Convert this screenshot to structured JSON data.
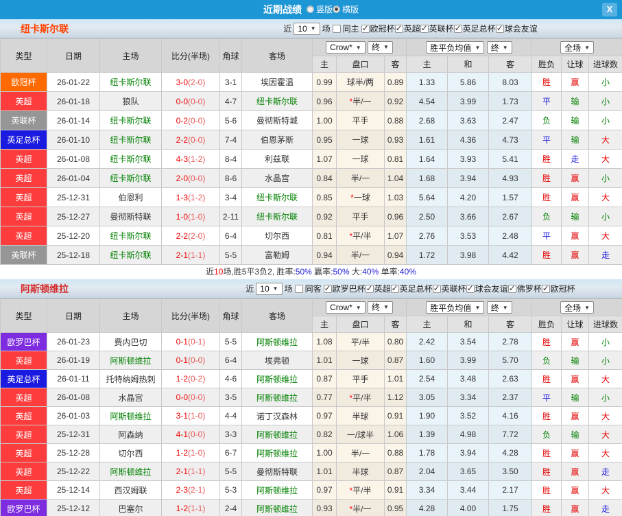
{
  "titlebar": {
    "title": "近期战绩",
    "orientation_options": [
      {
        "label": "竖版",
        "selected": false
      },
      {
        "label": "横版",
        "selected": true
      }
    ],
    "close_label": "X"
  },
  "table_header": {
    "col_type": "类型",
    "col_date": "日期",
    "col_home": "主场",
    "col_score": "比分(半场)",
    "col_corner": "角球",
    "col_away": "客场",
    "crow_select": "Crow*",
    "final_select_1": "终",
    "avg_select": "胜平负均值",
    "final_select_2": "终",
    "scope_select": "全场",
    "sub_home": "主",
    "sub_handicap": "盘口",
    "sub_away": "客",
    "sub_avg_home": "主",
    "sub_avg_draw": "和",
    "sub_avg_away": "客",
    "col_result": "胜负",
    "col_spread": "让球",
    "col_goals": "进球数"
  },
  "comp_colors": {
    "欧冠杯": "#ff6a00",
    "英超": "#fd3d3d",
    "英联杯": "#969696",
    "英足总杯": "#1a1ae0",
    "欧罗巴杯": "#7d2ce0"
  },
  "result_colors": {
    "胜": "#e60000",
    "平": "#1414dc",
    "负": "#018001",
    "赢": "#e60000",
    "输": "#018001",
    "走": "#1414dc",
    "大": "#e60000",
    "小": "#018001"
  },
  "sections": [
    {
      "team": "纽卡斯尔联",
      "team_color": "#ff4200",
      "filters": {
        "near_label": "近",
        "games": "10",
        "games_label": "场",
        "same_label": "同主",
        "same_checked": false,
        "competitions": [
          "欧冠杯",
          "英超",
          "英联杯",
          "英足总杯",
          "球会友谊"
        ]
      },
      "rows": [
        {
          "comp": "欧冠杯",
          "date": "26-01-22",
          "home": "纽卡斯尔联",
          "home_green": true,
          "score": "3-0",
          "half": "(2-0)",
          "corner": "3-1",
          "away": "埃因霍温",
          "away_green": false,
          "crow_home": "0.99",
          "handicap": "球半/两",
          "star": false,
          "crow_away": "0.89",
          "avg_home": "1.33",
          "avg_draw": "5.86",
          "avg_away": "8.03",
          "result": "胜",
          "spread": "赢",
          "goals": "小"
        },
        {
          "comp": "英超",
          "date": "26-01-18",
          "home": "狼队",
          "home_green": false,
          "score": "0-0",
          "half": "(0-0)",
          "corner": "4-7",
          "away": "纽卡斯尔联",
          "away_green": true,
          "crow_home": "0.96",
          "handicap": "半/一",
          "star": true,
          "crow_away": "0.92",
          "avg_home": "4.54",
          "avg_draw": "3.99",
          "avg_away": "1.73",
          "result": "平",
          "spread": "输",
          "goals": "小"
        },
        {
          "comp": "英联杯",
          "date": "26-01-14",
          "home": "纽卡斯尔联",
          "home_green": true,
          "score": "0-2",
          "half": "(0-0)",
          "corner": "5-6",
          "away": "曼彻斯特城",
          "away_green": false,
          "crow_home": "1.00",
          "handicap": "平手",
          "star": false,
          "crow_away": "0.88",
          "avg_home": "2.68",
          "avg_draw": "3.63",
          "avg_away": "2.47",
          "result": "负",
          "spread": "输",
          "goals": "小"
        },
        {
          "comp": "英足总杯",
          "date": "26-01-10",
          "home": "纽卡斯尔联",
          "home_green": true,
          "score": "2-2",
          "half": "(0-0)",
          "corner": "7-4",
          "away": "伯恩茅斯",
          "away_green": false,
          "crow_home": "0.95",
          "handicap": "一球",
          "star": false,
          "crow_away": "0.93",
          "avg_home": "1.61",
          "avg_draw": "4.36",
          "avg_away": "4.73",
          "result": "平",
          "spread": "输",
          "goals": "大"
        },
        {
          "comp": "英超",
          "date": "26-01-08",
          "home": "纽卡斯尔联",
          "home_green": true,
          "score": "4-3",
          "half": "(1-2)",
          "corner": "8-4",
          "away": "利兹联",
          "away_green": false,
          "crow_home": "1.07",
          "handicap": "一球",
          "star": false,
          "crow_away": "0.81",
          "avg_home": "1.64",
          "avg_draw": "3.93",
          "avg_away": "5.41",
          "result": "胜",
          "spread": "走",
          "goals": "大"
        },
        {
          "comp": "英超",
          "date": "26-01-04",
          "home": "纽卡斯尔联",
          "home_green": true,
          "score": "2-0",
          "half": "(0-0)",
          "corner": "8-6",
          "away": "水晶宫",
          "away_green": false,
          "crow_home": "0.84",
          "handicap": "半/一",
          "star": false,
          "crow_away": "1.04",
          "avg_home": "1.68",
          "avg_draw": "3.94",
          "avg_away": "4.93",
          "result": "胜",
          "spread": "赢",
          "goals": "小"
        },
        {
          "comp": "英超",
          "date": "25-12-31",
          "home": "伯恩利",
          "home_green": false,
          "score": "1-3",
          "half": "(1-2)",
          "corner": "3-4",
          "away": "纽卡斯尔联",
          "away_green": true,
          "crow_home": "0.85",
          "handicap": "一球",
          "star": true,
          "crow_away": "1.03",
          "avg_home": "5.64",
          "avg_draw": "4.20",
          "avg_away": "1.57",
          "result": "胜",
          "spread": "赢",
          "goals": "大"
        },
        {
          "comp": "英超",
          "date": "25-12-27",
          "home": "曼彻斯特联",
          "home_green": false,
          "score": "1-0",
          "half": "(1-0)",
          "corner": "2-11",
          "away": "纽卡斯尔联",
          "away_green": true,
          "crow_home": "0.92",
          "handicap": "平手",
          "star": false,
          "crow_away": "0.96",
          "avg_home": "2.50",
          "avg_draw": "3.66",
          "avg_away": "2.67",
          "result": "负",
          "spread": "输",
          "goals": "小"
        },
        {
          "comp": "英超",
          "date": "25-12-20",
          "home": "纽卡斯尔联",
          "home_green": true,
          "score": "2-2",
          "half": "(2-0)",
          "corner": "6-4",
          "away": "切尔西",
          "away_green": false,
          "crow_home": "0.81",
          "handicap": "平/半",
          "star": true,
          "crow_away": "1.07",
          "avg_home": "2.76",
          "avg_draw": "3.53",
          "avg_away": "2.48",
          "result": "平",
          "spread": "赢",
          "goals": "大"
        },
        {
          "comp": "英联杯",
          "date": "25-12-18",
          "home": "纽卡斯尔联",
          "home_green": true,
          "score": "2-1",
          "half": "(1-1)",
          "corner": "5-5",
          "away": "富勒姆",
          "away_green": false,
          "crow_home": "0.94",
          "handicap": "半/一",
          "star": false,
          "crow_away": "0.94",
          "avg_home": "1.72",
          "avg_draw": "3.98",
          "avg_away": "4.42",
          "result": "胜",
          "spread": "赢",
          "goals": "走"
        }
      ],
      "summary": [
        {
          "text": "近",
          "color": "#333333"
        },
        {
          "text": "10",
          "color": "#f00000"
        },
        {
          "text": "场,胜5平3负2, 胜率:",
          "color": "#333333"
        },
        {
          "text": "50%",
          "color": "#2323d6"
        },
        {
          "text": " 赢率:",
          "color": "#333333"
        },
        {
          "text": "50%",
          "color": "#2323d6"
        },
        {
          "text": " 大:",
          "color": "#333333"
        },
        {
          "text": "40%",
          "color": "#2323d6"
        },
        {
          "text": " 单率:",
          "color": "#333333"
        },
        {
          "text": "40%",
          "color": "#2323d6"
        }
      ]
    },
    {
      "team": "阿斯顿维拉",
      "team_color": "#d42a2a",
      "filters": {
        "near_label": "近",
        "games": "10",
        "games_label": "场",
        "same_label": "同客",
        "same_checked": false,
        "competitions": [
          "欧罗巴杯",
          "英超",
          "英足总杯",
          "英联杯",
          "球会友谊",
          "佛罗杯",
          "欧冠杯"
        ]
      },
      "rows": [
        {
          "comp": "欧罗巴杯",
          "date": "26-01-23",
          "home": "费内巴切",
          "home_green": false,
          "score": "0-1",
          "half": "(0-1)",
          "corner": "5-5",
          "away": "阿斯顿维拉",
          "away_green": true,
          "crow_home": "1.08",
          "handicap": "平/半",
          "star": false,
          "crow_away": "0.80",
          "avg_home": "2.42",
          "avg_draw": "3.54",
          "avg_away": "2.78",
          "result": "胜",
          "spread": "赢",
          "goals": "小"
        },
        {
          "comp": "英超",
          "date": "26-01-19",
          "home": "阿斯顿维拉",
          "home_green": true,
          "score": "0-1",
          "half": "(0-0)",
          "corner": "6-4",
          "away": "埃弗顿",
          "away_green": false,
          "crow_home": "1.01",
          "handicap": "一球",
          "star": false,
          "crow_away": "0.87",
          "avg_home": "1.60",
          "avg_draw": "3.99",
          "avg_away": "5.70",
          "result": "负",
          "spread": "输",
          "goals": "小"
        },
        {
          "comp": "英足总杯",
          "date": "26-01-11",
          "home": "托特纳姆热刺",
          "home_green": false,
          "score": "1-2",
          "half": "(0-2)",
          "corner": "4-6",
          "away": "阿斯顿维拉",
          "away_green": true,
          "crow_home": "0.87",
          "handicap": "平手",
          "star": false,
          "crow_away": "1.01",
          "avg_home": "2.54",
          "avg_draw": "3.48",
          "avg_away": "2.63",
          "result": "胜",
          "spread": "赢",
          "goals": "大"
        },
        {
          "comp": "英超",
          "date": "26-01-08",
          "home": "水晶宫",
          "home_green": false,
          "score": "0-0",
          "half": "(0-0)",
          "corner": "3-5",
          "away": "阿斯顿维拉",
          "away_green": true,
          "crow_home": "0.77",
          "handicap": "平/半",
          "star": true,
          "crow_away": "1.12",
          "avg_home": "3.05",
          "avg_draw": "3.34",
          "avg_away": "2.37",
          "result": "平",
          "spread": "输",
          "goals": "小"
        },
        {
          "comp": "英超",
          "date": "26-01-03",
          "home": "阿斯顿维拉",
          "home_green": true,
          "score": "3-1",
          "half": "(1-0)",
          "corner": "4-4",
          "away": "诺丁汉森林",
          "away_green": false,
          "crow_home": "0.97",
          "handicap": "半球",
          "star": false,
          "crow_away": "0.91",
          "avg_home": "1.90",
          "avg_draw": "3.52",
          "avg_away": "4.16",
          "result": "胜",
          "spread": "赢",
          "goals": "大"
        },
        {
          "comp": "英超",
          "date": "25-12-31",
          "home": "阿森纳",
          "home_green": false,
          "score": "4-1",
          "half": "(0-0)",
          "corner": "3-3",
          "away": "阿斯顿维拉",
          "away_green": true,
          "crow_home": "0.82",
          "handicap": "一/球半",
          "star": false,
          "crow_away": "1.06",
          "avg_home": "1.39",
          "avg_draw": "4.98",
          "avg_away": "7.72",
          "result": "负",
          "spread": "输",
          "goals": "大"
        },
        {
          "comp": "英超",
          "date": "25-12-28",
          "home": "切尔西",
          "home_green": false,
          "score": "1-2",
          "half": "(1-0)",
          "corner": "6-7",
          "away": "阿斯顿维拉",
          "away_green": true,
          "crow_home": "1.00",
          "handicap": "半/一",
          "star": false,
          "crow_away": "0.88",
          "avg_home": "1.78",
          "avg_draw": "3.94",
          "avg_away": "4.28",
          "result": "胜",
          "spread": "赢",
          "goals": "大"
        },
        {
          "comp": "英超",
          "date": "25-12-22",
          "home": "阿斯顿维拉",
          "home_green": true,
          "score": "2-1",
          "half": "(1-1)",
          "corner": "5-5",
          "away": "曼彻斯特联",
          "away_green": false,
          "crow_home": "1.01",
          "handicap": "半球",
          "star": false,
          "crow_away": "0.87",
          "avg_home": "2.04",
          "avg_draw": "3.65",
          "avg_away": "3.50",
          "result": "胜",
          "spread": "赢",
          "goals": "走"
        },
        {
          "comp": "英超",
          "date": "25-12-14",
          "home": "西汉姆联",
          "home_green": false,
          "score": "2-3",
          "half": "(2-1)",
          "corner": "5-3",
          "away": "阿斯顿维拉",
          "away_green": true,
          "crow_home": "0.97",
          "handicap": "平/半",
          "star": true,
          "crow_away": "0.91",
          "avg_home": "3.34",
          "avg_draw": "3.44",
          "avg_away": "2.17",
          "result": "胜",
          "spread": "赢",
          "goals": "大"
        },
        {
          "comp": "欧罗巴杯",
          "date": "25-12-12",
          "home": "巴塞尔",
          "home_green": false,
          "score": "1-2",
          "half": "(1-1)",
          "corner": "2-4",
          "away": "阿斯顿维拉",
          "away_green": true,
          "crow_home": "0.93",
          "handicap": "半/一",
          "star": true,
          "crow_away": "0.95",
          "avg_home": "4.28",
          "avg_draw": "4.00",
          "avg_away": "1.75",
          "result": "胜",
          "spread": "赢",
          "goals": "走"
        }
      ],
      "summary": null
    }
  ]
}
